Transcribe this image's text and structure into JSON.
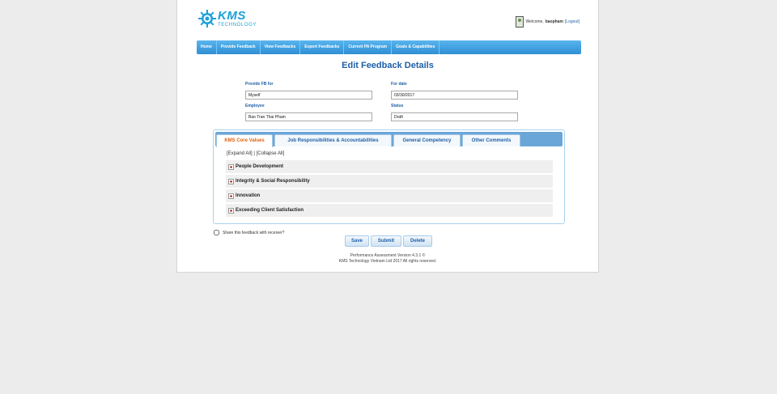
{
  "logo": {
    "name": "KMS",
    "tagline": "TECHNOLOGY",
    "color": "#1ea0d8"
  },
  "user": {
    "welcome": "Welcome,",
    "username": "baopham",
    "logout": "[Logout]"
  },
  "nav": {
    "items": [
      "Home",
      "Provide Feedback",
      "View Feedbacks",
      "Export Feedbacks",
      "Current PA Program",
      "Goals & Capabilities"
    ]
  },
  "page_title": "Edit Feedback Details",
  "form": {
    "provide_fb_for": {
      "label": "Provide FB for",
      "value": "Myself"
    },
    "for_date": {
      "label": "For date",
      "value": "03/30/2017"
    },
    "employee": {
      "label": "Employee",
      "value": "Bao Tran Thai Pham"
    },
    "status": {
      "label": "Status",
      "value": "Draft"
    }
  },
  "tabs": {
    "items": [
      "KMS Core Values",
      "Job Responsibilities & Accountabilities",
      "General Competency",
      "Other Comments"
    ],
    "active": 0
  },
  "expand_collapse": {
    "expand": "[Expand All]",
    "separator": "|",
    "collapse": "[Collapse All]"
  },
  "sections": [
    "People Development",
    "Integrity & Social Responsibility",
    "Innovation",
    "Exceeding Client Satisfaction"
  ],
  "share_label": "Share this feedback with receiver?",
  "buttons": {
    "save": "Save",
    "submit": "Submit",
    "delete": "Delete"
  },
  "footer": {
    "line1": "Performance Assessment Version 4.3.1 ©",
    "line2": "KMS Technology Vietnam Ltd 2017 All rights reserved."
  },
  "colors": {
    "accent": "#1e5fa8",
    "nav": "#2f8fd4",
    "active_tab": "#e0620e"
  }
}
